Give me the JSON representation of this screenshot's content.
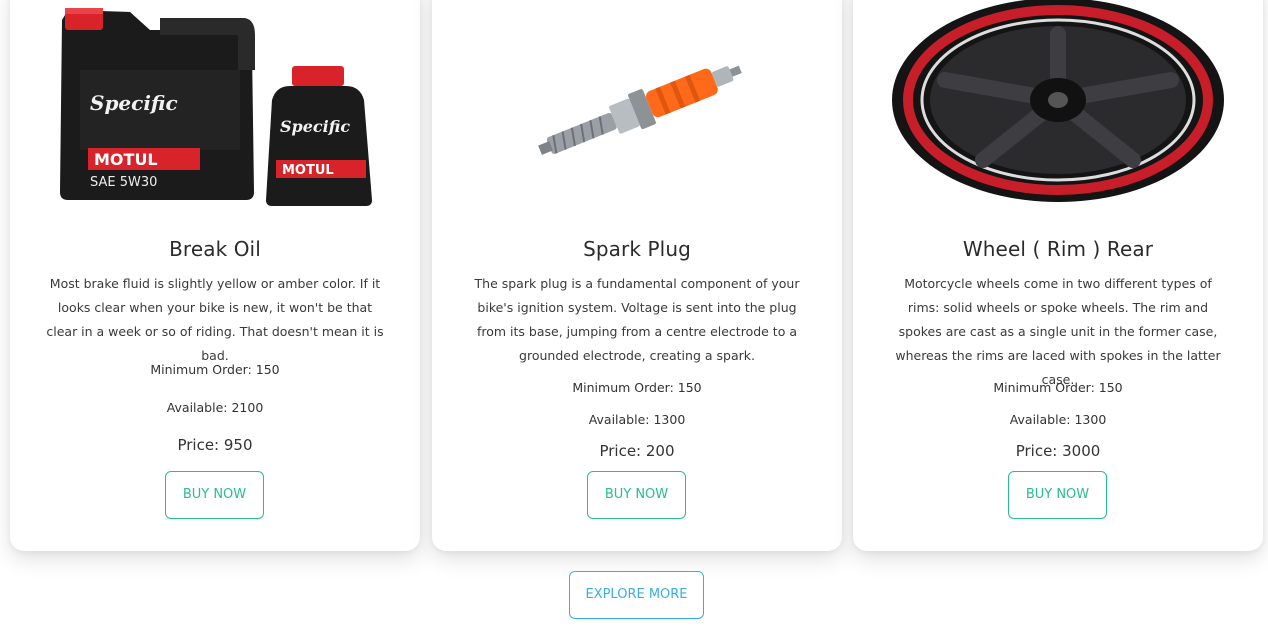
{
  "products": [
    {
      "image_icon": "motor-oil-bottles-image",
      "title": "Break Oil",
      "description": "Most brake fluid is slightly yellow or amber color. If it looks clear when your bike is new, it won't be that clear in a week or so of riding. That doesn't mean it is bad.",
      "min_order": "Minimum Order: 150",
      "available": "Available: 2100",
      "price": "Price: 950",
      "buy_label": "BUY NOW",
      "brand_text": [
        "Specific",
        "MOTUL",
        "SAE 5W30",
        "Specific",
        "MOTUL"
      ]
    },
    {
      "image_icon": "spark-plug-image",
      "title": "Spark Plug",
      "description": "The spark plug is a fundamental component of your bike's ignition system. Voltage is sent into the plug from its base, jumping from a centre electrode to a grounded electrode, creating a spark.",
      "min_order": "Minimum Order: 150",
      "available": "Available: 1300",
      "price": "Price: 200",
      "buy_label": "BUY NOW"
    },
    {
      "image_icon": "motorcycle-wheel-image",
      "title": "Wheel ( Rim ) Rear",
      "description": "Motorcycle wheels come in two different types of rims: solid wheels or spoke wheels. The rim and spokes are cast as a single unit in the former case, whereas the rims are laced with spokes in the latter case.",
      "min_order": "Minimum Order: 150",
      "available": "Available: 1300",
      "price": "Price: 3000",
      "buy_label": "BUY NOW"
    }
  ],
  "explore_label": "EXPLORE MORE",
  "colors": {
    "buy_accent": "#2bbd8c",
    "explore_accent": "#39aee0"
  }
}
